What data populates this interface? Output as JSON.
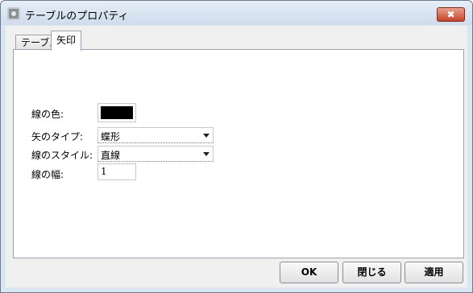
{
  "window": {
    "title": "テーブルのプロパティ",
    "close_label": "✖"
  },
  "tabs": [
    {
      "label": "テーブル",
      "active": false
    },
    {
      "label": "矢印",
      "active": true
    }
  ],
  "form": {
    "line_color_label": "線の色:",
    "line_color_value": "#000000",
    "arrow_type_label": "矢のタイプ:",
    "arrow_type_value": "蝶形",
    "line_style_label": "線のスタイル:",
    "line_style_value": "直線",
    "line_width_label": "線の幅:",
    "line_width_value": "1"
  },
  "buttons": {
    "ok": "OK",
    "close": "閉じる",
    "apply": "適用"
  },
  "icons": {
    "app": "settings-gear-icon",
    "dropdown": "chevron-down-icon",
    "close": "close-icon"
  }
}
